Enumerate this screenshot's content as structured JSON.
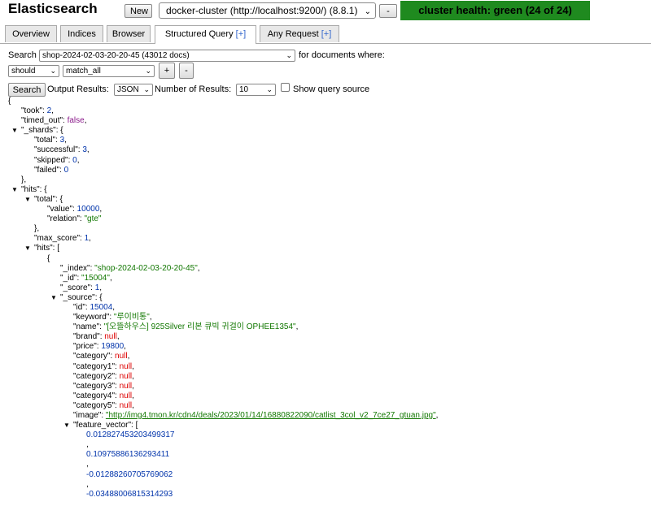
{
  "header": {
    "app_title": "Elasticsearch",
    "new_label": "New",
    "cluster_selected": "docker-cluster (http://localhost:9200/) (8.8.1)",
    "remove_label": "-",
    "health_text": "cluster health: green (24 of 24)",
    "health_color": "#1f8a1f"
  },
  "tabs": [
    {
      "label": "Overview",
      "plus": ""
    },
    {
      "label": "Indices",
      "plus": ""
    },
    {
      "label": "Browser",
      "plus": ""
    },
    {
      "label": "Structured Query ",
      "plus": "[+]"
    },
    {
      "label": "Any Request ",
      "plus": "[+]"
    }
  ],
  "query": {
    "search_label": "Search",
    "index_selected": "shop-2024-02-03-20-20-45 (43012 docs)",
    "for_docs_label": "for documents where:",
    "bool_selected": "should",
    "clause_selected": "match_all",
    "add_label": "+",
    "remove_label": "-",
    "search_button": "Search",
    "output_label": "Output Results:",
    "output_selected": "JSON",
    "num_label": "Number of Results:",
    "num_selected": "10",
    "show_source_label": "Show query source"
  },
  "result_lines": [
    {
      "t": "{",
      "i": 0
    },
    {
      "k": "\"took\"",
      "v": "2",
      "c": "num",
      "e": ",",
      "i": 1
    },
    {
      "k": "\"timed_out\"",
      "v": "false",
      "c": "bool",
      "e": ",",
      "i": 1
    },
    {
      "k": "\"_shards\"",
      "o": "{",
      "i": 1,
      "tri": true
    },
    {
      "k": "\"total\"",
      "v": "3",
      "c": "num",
      "e": ",",
      "i": 2
    },
    {
      "k": "\"successful\"",
      "v": "3",
      "c": "num",
      "e": ",",
      "i": 2
    },
    {
      "k": "\"skipped\"",
      "v": "0",
      "c": "num",
      "e": ",",
      "i": 2
    },
    {
      "k": "\"failed\"",
      "v": "0",
      "c": "num",
      "e": "",
      "i": 2
    },
    {
      "t": "},",
      "i": 1
    },
    {
      "k": "\"hits\"",
      "o": "{",
      "i": 1,
      "tri": true
    },
    {
      "k": "\"total\"",
      "o": "{",
      "i": 2,
      "tri": true
    },
    {
      "k": "\"value\"",
      "v": "10000",
      "c": "num",
      "e": ",",
      "i": 3
    },
    {
      "k": "\"relation\"",
      "v": "\"gte\"",
      "c": "str",
      "e": "",
      "i": 3
    },
    {
      "t": "},",
      "i": 2
    },
    {
      "k": "\"max_score\"",
      "v": "1",
      "c": "num",
      "e": ",",
      "i": 2
    },
    {
      "k": "\"hits\"",
      "o": "[",
      "i": 2,
      "tri": true
    },
    {
      "t": "{",
      "i": 3
    },
    {
      "k": "\"_index\"",
      "v": "\"shop-2024-02-03-20-20-45\"",
      "c": "str",
      "e": ",",
      "i": 4
    },
    {
      "k": "\"_id\"",
      "v": "\"15004\"",
      "c": "str",
      "e": ",",
      "i": 4
    },
    {
      "k": "\"_score\"",
      "v": "1",
      "c": "num",
      "e": ",",
      "i": 4
    },
    {
      "k": "\"_source\"",
      "o": "{",
      "i": 4,
      "tri": true
    },
    {
      "k": "\"id\"",
      "v": "15004",
      "c": "num",
      "e": ",",
      "i": 5
    },
    {
      "k": "\"keyword\"",
      "v": "\"루이비통\"",
      "c": "str",
      "e": ",",
      "i": 5
    },
    {
      "k": "\"name\"",
      "v": "\"[오뜰하우스] 925Silver 리본 큐빅 귀걸이 OPHEE1354\"",
      "c": "str",
      "e": ",",
      "i": 5
    },
    {
      "k": "\"brand\"",
      "v": "null",
      "c": "nul",
      "e": ",",
      "i": 5
    },
    {
      "k": "\"price\"",
      "v": "19800",
      "c": "num",
      "e": ",",
      "i": 5
    },
    {
      "k": "\"category\"",
      "v": "null",
      "c": "nul",
      "e": ",",
      "i": 5
    },
    {
      "k": "\"category1\"",
      "v": "null",
      "c": "nul",
      "e": ",",
      "i": 5
    },
    {
      "k": "\"category2\"",
      "v": "null",
      "c": "nul",
      "e": ",",
      "i": 5
    },
    {
      "k": "\"category3\"",
      "v": "null",
      "c": "nul",
      "e": ",",
      "i": 5
    },
    {
      "k": "\"category4\"",
      "v": "null",
      "c": "nul",
      "e": ",",
      "i": 5
    },
    {
      "k": "\"category5\"",
      "v": "null",
      "c": "nul",
      "e": ",",
      "i": 5
    },
    {
      "k": "\"image\"",
      "v": "\"http://img4.tmon.kr/cdn4/deals/2023/01/14/16880822090/catlist_3col_v2_7ce27_gtuan.jpg\"",
      "c": "link",
      "e": ",",
      "i": 5
    },
    {
      "k": "\"feature_vector\"",
      "o": "[",
      "i": 5,
      "tri": true
    },
    {
      "t": "0.012827453203499317",
      "i": 6,
      "c": "num"
    },
    {
      "t": ",",
      "i": 6
    },
    {
      "t": "0.10975886136293411",
      "i": 6,
      "c": "num"
    },
    {
      "t": ",",
      "i": 6
    },
    {
      "t": "-0.01288260705769062",
      "i": 6,
      "c": "num"
    },
    {
      "t": ",",
      "i": 6
    },
    {
      "t": "-0.03488006815314293",
      "i": 6,
      "c": "num"
    }
  ]
}
